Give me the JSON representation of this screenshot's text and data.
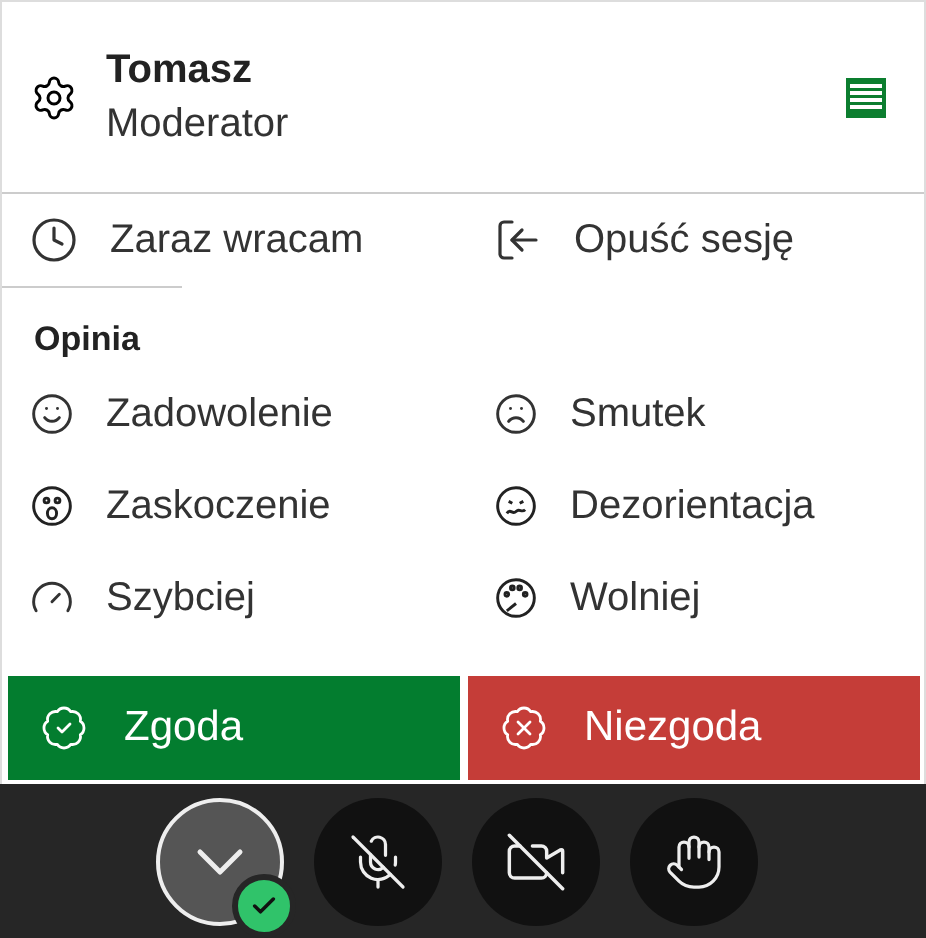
{
  "user": {
    "name": "Tomasz",
    "role": "Moderator"
  },
  "status_actions": [
    {
      "kind": "away",
      "label": "Zaraz wracam"
    },
    {
      "kind": "leave",
      "label": "Opuść sesję"
    }
  ],
  "feedback": {
    "heading": "Opinia",
    "items": [
      {
        "kind": "happy",
        "label": "Zadowolenie"
      },
      {
        "kind": "sad",
        "label": "Smutek"
      },
      {
        "kind": "surprised",
        "label": "Zaskoczenie"
      },
      {
        "kind": "confused",
        "label": "Dezorientacja"
      },
      {
        "kind": "faster",
        "label": "Szybciej"
      },
      {
        "kind": "slower",
        "label": "Wolniej"
      }
    ]
  },
  "votes": [
    {
      "kind": "agree",
      "label": "Zgoda"
    },
    {
      "kind": "disagree",
      "label": "Niezgoda"
    }
  ],
  "toolbar": [
    {
      "kind": "avatar",
      "online": true
    },
    {
      "kind": "mic-off"
    },
    {
      "kind": "camera-off"
    },
    {
      "kind": "hand"
    }
  ]
}
